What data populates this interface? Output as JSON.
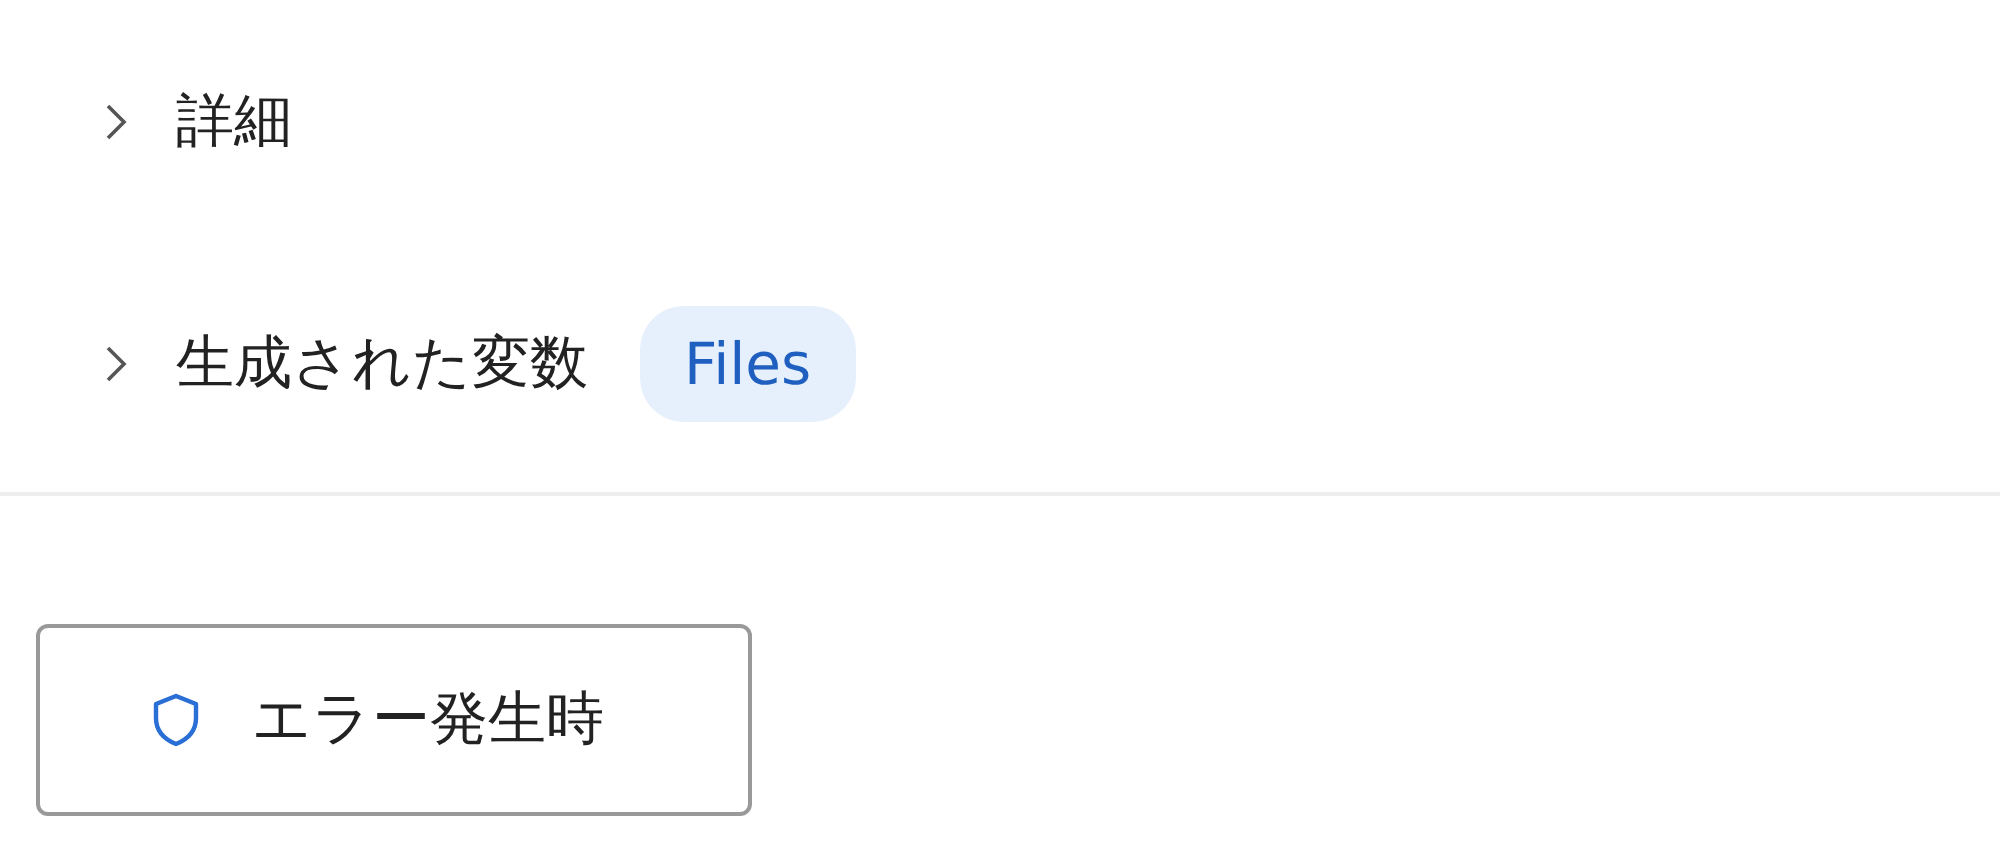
{
  "sections": [
    {
      "label": "詳細",
      "expanded": false
    },
    {
      "label": "生成された変数",
      "expanded": false,
      "tags": [
        "Files"
      ]
    }
  ],
  "error_button": {
    "label": "エラー発生時"
  }
}
